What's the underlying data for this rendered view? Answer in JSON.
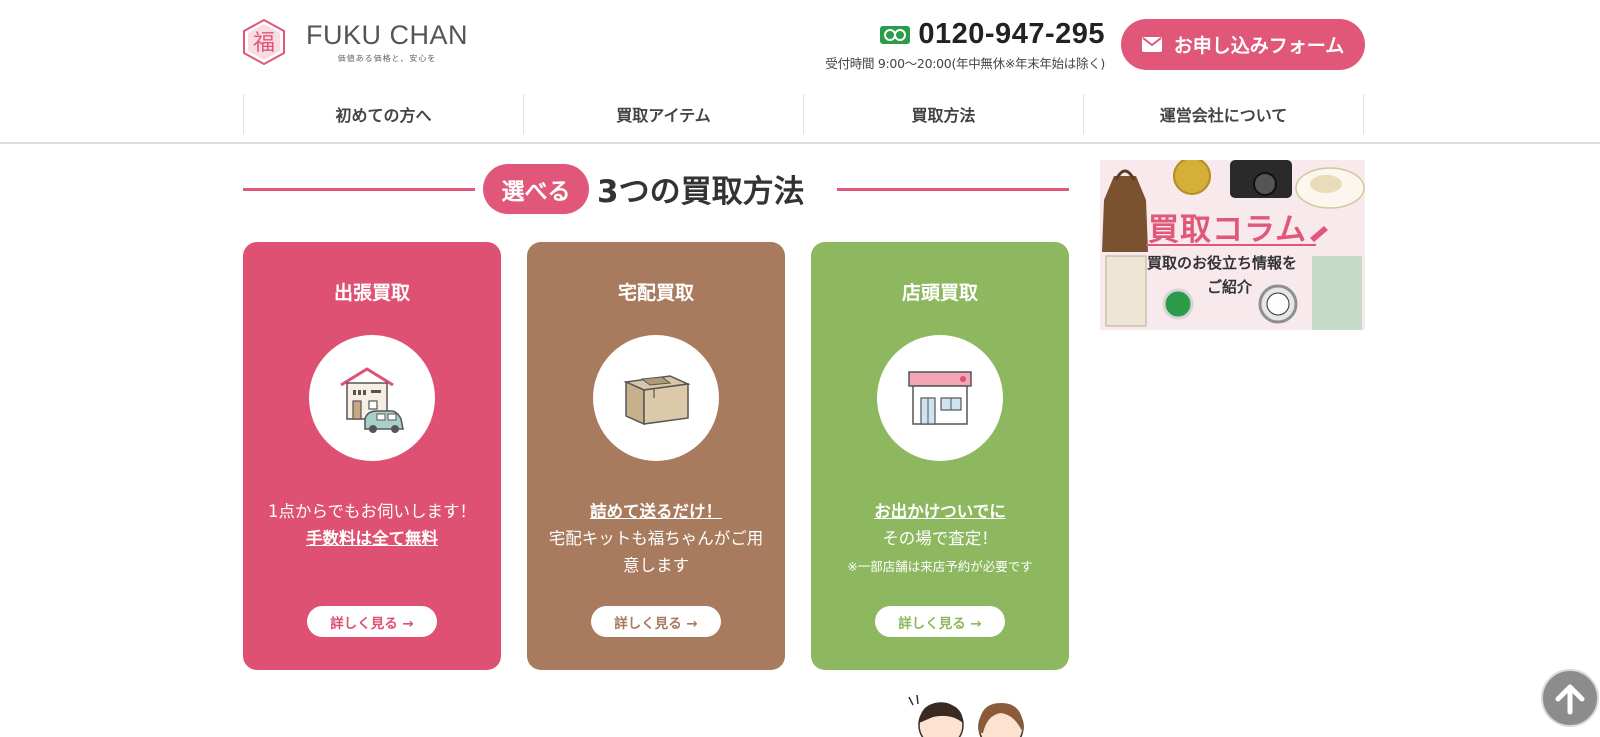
{
  "header": {
    "logo_name": "FUKU CHAN",
    "logo_tagline": "価値ある価格と、安心を",
    "logo_kanji": "福",
    "phone": "0120-947-295",
    "hours": "受付時間 9:00〜20:00(年中無休※年末年始は除く)",
    "apply_button": "お申し込みフォーム"
  },
  "nav": [
    {
      "label": "初めての方へ"
    },
    {
      "label": "買取アイテム"
    },
    {
      "label": "買取方法"
    },
    {
      "label": "運営会社について"
    }
  ],
  "section": {
    "badge": "選べる",
    "title": "3つの買取方法"
  },
  "cards": [
    {
      "title": "出張買取",
      "desc_line1": "1点からでもお伺いします！",
      "desc_link": "手数料は全て無料",
      "button": "詳しく見る →",
      "color": "#df5172",
      "icon": "house-car-icon"
    },
    {
      "title": "宅配買取",
      "desc_link": "詰めて送るだけ！",
      "desc_line1": "宅配キットも福ちゃんがご用意します",
      "button": "詳しく見る →",
      "color": "#a87a5e",
      "icon": "cardboard-box-icon"
    },
    {
      "title": "店頭買取",
      "desc_link": "お出かけついでに",
      "desc_line1": "その場で査定！",
      "note": "※一部店舗は来店予約が必要です",
      "button": "詳しく見る →",
      "color": "#8db860",
      "icon": "storefront-icon"
    }
  ],
  "banner": {
    "title": "買取コラム",
    "sub1": "買取のお役立ち情報を",
    "sub2": "ご紹介"
  },
  "colors": {
    "accent": "#e0577a",
    "text": "#333333"
  }
}
